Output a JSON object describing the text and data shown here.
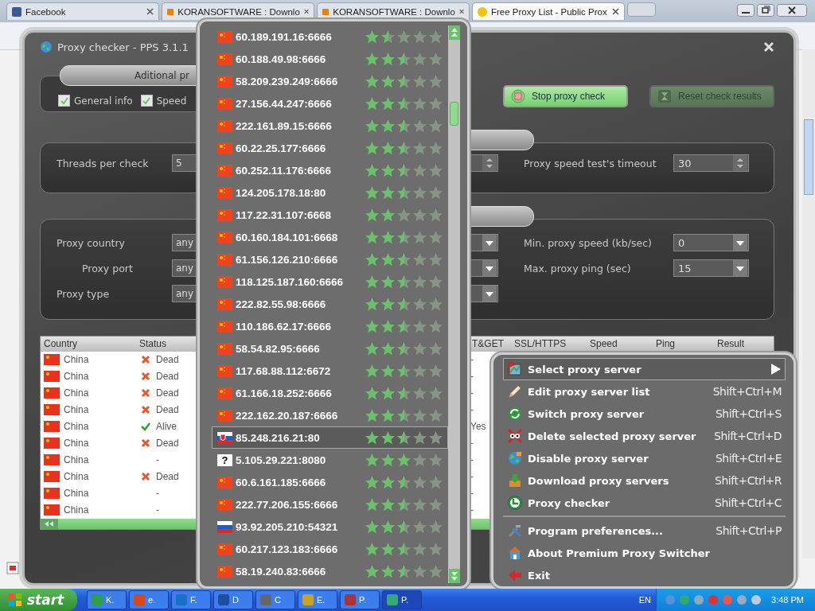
{
  "browser": {
    "tabs": [
      {
        "title": "Facebook",
        "selected": false
      },
      {
        "title": "KORANSOFTWARE : Downlo",
        "selected": false
      },
      {
        "title": "KORANSOFTWARE : Downlo",
        "selected": false
      },
      {
        "title": "Free Proxy List - Public Prox",
        "selected": true
      }
    ]
  },
  "checker": {
    "title": "Proxy checker - PPS 3.1.1",
    "options_tab": "Aditional pr",
    "options": [
      {
        "label": "General info",
        "checked": true
      },
      {
        "label": "Speed",
        "checked": true
      }
    ],
    "buttons": [
      {
        "label": "Stop proxy check",
        "disabled": false
      },
      {
        "label": "Reset check results",
        "disabled": true
      }
    ],
    "threads": {
      "label": "Threads per check",
      "value": "5"
    },
    "timeout": {
      "label": "Proxy speed test's timeout",
      "value": "30"
    },
    "filters_left": [
      {
        "label": "Proxy country",
        "value": "any"
      },
      {
        "label": "Proxy port",
        "value": "any"
      },
      {
        "label": "Proxy type",
        "value": "any"
      }
    ],
    "filters_right": [
      {
        "label": "Min. proxy speed (kb/sec)",
        "value": "0"
      },
      {
        "label": "Max. proxy ping (sec)",
        "value": "15"
      }
    ],
    "table": {
      "columns": [
        "Country",
        "Status",
        "T&GET",
        "SSL/HTTPS",
        "Speed",
        "Ping",
        "Result"
      ],
      "rows": [
        {
          "kind": "dead",
          "country": "China",
          "status_text": "Dead",
          "column_3": "-"
        },
        {
          "kind": "dead",
          "country": "China",
          "status_text": "Dead",
          "column_3": "-"
        },
        {
          "kind": "dead",
          "country": "China",
          "status_text": "Dead",
          "column_3": "-"
        },
        {
          "kind": "dead",
          "country": "China",
          "status_text": "Dead",
          "column_3": "-"
        },
        {
          "kind": "alive",
          "country": "China",
          "status_text": "Alive",
          "column_3": "Yes"
        },
        {
          "kind": "dead",
          "country": "China",
          "status_text": "Dead",
          "column_3": "-"
        },
        {
          "kind": "unchecked",
          "country": "China",
          "status_text": "-",
          "column_3": "-"
        },
        {
          "kind": "dead",
          "country": "China",
          "status_text": "Dead",
          "column_3": "-"
        },
        {
          "kind": "unchecked",
          "country": "China",
          "status_text": "-",
          "column_3": "-"
        },
        {
          "kind": "unchecked",
          "country": "China",
          "status_text": "-",
          "column_3": "-"
        }
      ]
    }
  },
  "proxy_list": {
    "items": [
      {
        "kind": "china",
        "address": "60.189.191.16:6666",
        "stars": 1.5,
        "selected": false
      },
      {
        "kind": "china",
        "address": "60.188.49.98:6666",
        "stars": 2.5,
        "selected": false
      },
      {
        "kind": "china",
        "address": "58.209.239.249:6666",
        "stars": 2.5,
        "selected": false
      },
      {
        "kind": "china",
        "address": "27.156.44.247:6666",
        "stars": 2.5,
        "selected": false
      },
      {
        "kind": "china",
        "address": "222.161.89.15:6666",
        "stars": 2.5,
        "selected": false
      },
      {
        "kind": "china",
        "address": "60.22.25.177:6666",
        "stars": 2.5,
        "selected": false
      },
      {
        "kind": "china",
        "address": "60.252.11.176:6666",
        "stars": 2.5,
        "selected": false
      },
      {
        "kind": "china",
        "address": "124.205.178.18:80",
        "stars": 2.5,
        "selected": false
      },
      {
        "kind": "china",
        "address": "117.22.31.107:6668",
        "stars": 2,
        "selected": false
      },
      {
        "kind": "china",
        "address": "60.160.184.101:6668",
        "stars": 2.5,
        "selected": false
      },
      {
        "kind": "china",
        "address": "61.156.126.210:6666",
        "stars": 2.5,
        "selected": false
      },
      {
        "kind": "china",
        "address": "118.125.187.160:6666",
        "stars": 2.5,
        "selected": false
      },
      {
        "kind": "china",
        "address": "222.82.55.98:6666",
        "stars": 2.5,
        "selected": false
      },
      {
        "kind": "china",
        "address": "110.186.62.17:6666",
        "stars": 2.5,
        "selected": false
      },
      {
        "kind": "china",
        "address": "58.54.82.95:6666",
        "stars": 2.5,
        "selected": false
      },
      {
        "kind": "china",
        "address": "117.68.88.112:6672",
        "stars": 2.5,
        "selected": false
      },
      {
        "kind": "china",
        "address": "61.166.18.252:6666",
        "stars": 2.5,
        "selected": false
      },
      {
        "kind": "china",
        "address": "222.162.20.187:6666",
        "stars": 2.5,
        "selected": false
      },
      {
        "kind": "slovakia",
        "address": "85.248.216.21:80",
        "stars": 2.5,
        "selected": true
      },
      {
        "kind": "unknown",
        "flag_text": "?",
        "address": "5.105.29.221:8080",
        "stars": 3,
        "selected": false
      },
      {
        "kind": "china",
        "address": "60.6.161.185:6666",
        "stars": 2.5,
        "selected": false
      },
      {
        "kind": "china",
        "address": "222.77.206.155:6666",
        "stars": 2.5,
        "selected": false
      },
      {
        "kind": "russia",
        "address": "93.92.205.210:54321",
        "stars": 2.5,
        "selected": false
      },
      {
        "kind": "china",
        "address": "60.217.123.183:6666",
        "stars": 2.5,
        "selected": false
      },
      {
        "kind": "china",
        "address": "58.19.240.83:6666",
        "stars": 2.5,
        "selected": false
      }
    ]
  },
  "menu": {
    "items": [
      {
        "kind": "item",
        "label": "Select proxy server",
        "selected": true,
        "submenu": true
      },
      {
        "kind": "item",
        "label": "Edit proxy server list",
        "shortcut": "Shift+Ctrl+M",
        "selected": false,
        "submenu": false
      },
      {
        "kind": "item",
        "label": "Switch proxy server",
        "shortcut": "Shift+Ctrl+S",
        "selected": false,
        "submenu": false
      },
      {
        "kind": "item",
        "label": "Delete selected proxy server",
        "shortcut": "Shift+Ctrl+D",
        "selected": false,
        "submenu": false
      },
      {
        "kind": "item",
        "label": "Disable proxy server",
        "shortcut": "Shift+Ctrl+E",
        "selected": false,
        "submenu": false
      },
      {
        "kind": "item",
        "label": "Download proxy servers",
        "shortcut": "Shift+Ctrl+R",
        "selected": false,
        "submenu": false
      },
      {
        "kind": "item",
        "label": "Proxy checker",
        "shortcut": "Shift+Ctrl+C",
        "selected": false,
        "submenu": false
      },
      {
        "kind": "separator"
      },
      {
        "kind": "item",
        "label": "Program preferences...",
        "shortcut": "Shift+Ctrl+P",
        "selected": false,
        "submenu": false
      },
      {
        "kind": "item",
        "label": "About Premium Proxy Switcher",
        "selected": false,
        "submenu": false
      },
      {
        "kind": "item",
        "label": "Exit",
        "selected": false,
        "submenu": false
      }
    ]
  },
  "taskbar": {
    "start": "start",
    "tasks": [
      {
        "label": "K.",
        "active": false
      },
      {
        "label": "e.",
        "active": false
      },
      {
        "label": "F.",
        "active": false
      },
      {
        "label": "D",
        "active": false
      },
      {
        "label": "C",
        "active": false
      },
      {
        "label": "E.",
        "active": false
      },
      {
        "label": "P.",
        "active": false
      },
      {
        "label": "P.",
        "active": true
      }
    ],
    "language": "EN",
    "clock": "3:48 PM"
  }
}
